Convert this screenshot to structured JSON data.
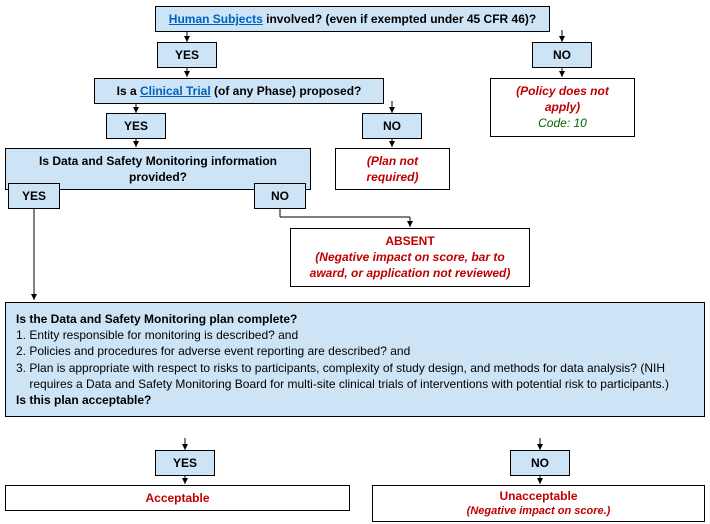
{
  "q1": {
    "link": "Human Subjects",
    "rest": " involved? (even if exempted under 45 CFR 46)?",
    "yes": "YES",
    "no": "NO"
  },
  "policy_na": {
    "line1": "(Policy does not apply)",
    "code_label": "Code:",
    "code_value": "10"
  },
  "q2": {
    "pre": "Is a ",
    "link": "Clinical Trial",
    "post": " (of any Phase) proposed?",
    "yes": "YES",
    "no": "NO"
  },
  "plan_not_required": "(Plan not required)",
  "q3": {
    "text": "Is Data and Safety Monitoring information provided?",
    "yes": "YES",
    "no": "NO"
  },
  "absent": {
    "title": "ABSENT",
    "sub": "(Negative impact on score, bar to award, or application not reviewed)"
  },
  "q4": {
    "heading": "Is the Data and Safety Monitoring plan complete?",
    "item1": "1. Entity responsible for monitoring is described? and",
    "item2": "2. Policies and procedures for adverse event reporting are described? and",
    "item3": "3. Plan is appropriate with respect to risks to participants, complexity of study design, and methods for data analysis? (NIH requires a Data and Safety Monitoring Board for multi-site clinical trials of interventions with potential risk to participants.)",
    "closing": "Is this plan acceptable?",
    "yes": "YES",
    "no": "NO"
  },
  "acceptable": "Acceptable",
  "unacceptable": {
    "title": "Unacceptable",
    "sub": "(Negative impact on score.)"
  }
}
